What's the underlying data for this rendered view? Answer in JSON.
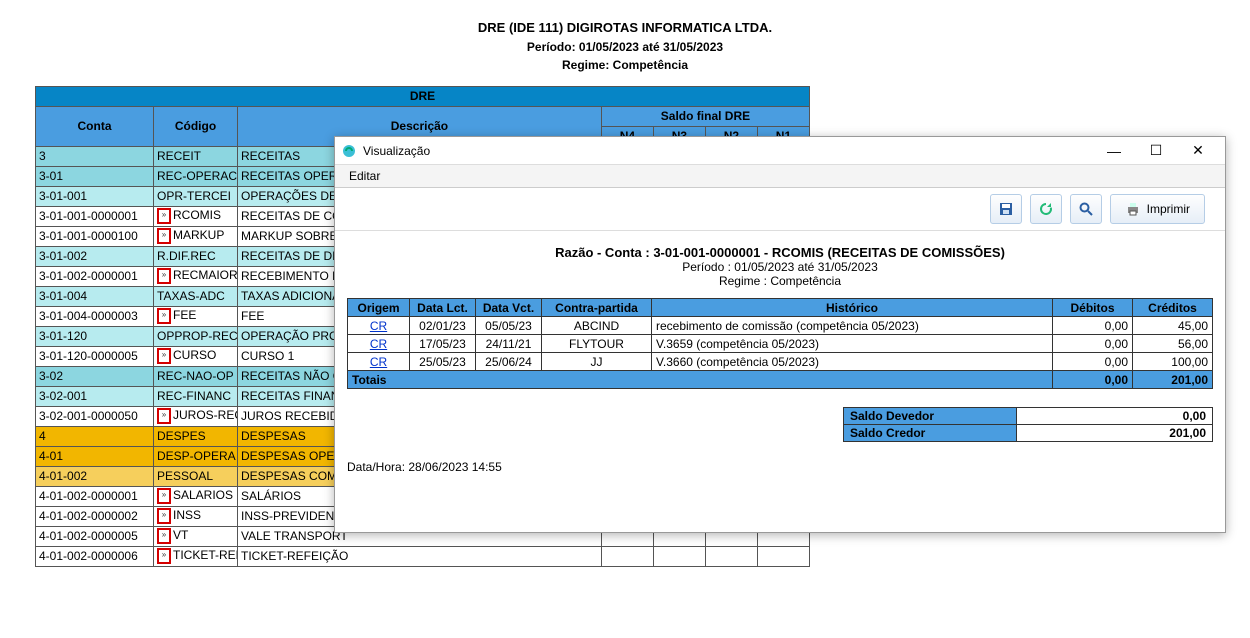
{
  "report": {
    "title": "DRE (IDE 111) DIGIROTAS INFORMATICA LTDA.",
    "periodo": "Período: 01/05/2023 até 31/05/2023",
    "regime": "Regime: Competência"
  },
  "dre": {
    "title": "DRE",
    "headers": {
      "conta": "Conta",
      "codigo": "Código",
      "descricao": "Descrição",
      "saldo": "Saldo final DRE",
      "n4": "N4",
      "n3": "N3",
      "n2": "N2",
      "n1": "N1"
    },
    "rows": [
      {
        "lvl": "lvl1",
        "conta": "3",
        "codigo": "RECEIT",
        "desc": "RECEITAS",
        "mark": false
      },
      {
        "lvl": "lvl2",
        "conta": "3-01",
        "codigo": "REC-OPERAC",
        "desc": "RECEITAS OPERAC",
        "mark": false
      },
      {
        "lvl": "lvl3",
        "conta": "3-01-001",
        "codigo": "OPR-TERCEI",
        "desc": "OPERAÇÕES DE T",
        "mark": false
      },
      {
        "lvl": "lvl4",
        "conta": "3-01-001-0000001",
        "codigo": "RCOMIS",
        "desc": "RECEITAS DE CO",
        "mark": true
      },
      {
        "lvl": "lvl4",
        "conta": "3-01-001-0000100",
        "codigo": "MARKUP",
        "desc": "MARKUP SOBRE V",
        "mark": true
      },
      {
        "lvl": "lvl3",
        "conta": "3-01-002",
        "codigo": "R.DIF.REC",
        "desc": "RECEITAS DE DIFE",
        "mark": false
      },
      {
        "lvl": "lvl4",
        "conta": "3-01-002-0000001",
        "codigo": "RECMAIOR",
        "desc": "RECEBIMENTO DE",
        "mark": true
      },
      {
        "lvl": "lvl3",
        "conta": "3-01-004",
        "codigo": "TAXAS-ADC",
        "desc": "TAXAS ADICIONAI",
        "mark": false
      },
      {
        "lvl": "lvl4",
        "conta": "3-01-004-0000003",
        "codigo": "FEE",
        "desc": "FEE",
        "mark": true
      },
      {
        "lvl": "lvl3",
        "conta": "3-01-120",
        "codigo": "OPPROP-REC",
        "desc": "OPERAÇÃO PROP",
        "mark": false
      },
      {
        "lvl": "lvl4",
        "conta": "3-01-120-0000005",
        "codigo": "CURSO",
        "desc": "CURSO 1",
        "mark": true
      },
      {
        "lvl": "lvl2",
        "conta": "3-02",
        "codigo": "REC-NAO-OP",
        "desc": "RECEITAS NÃO OP",
        "mark": false
      },
      {
        "lvl": "lvl3",
        "conta": "3-02-001",
        "codigo": "REC-FINANC",
        "desc": "RECEITAS FINANC",
        "mark": false
      },
      {
        "lvl": "lvl4",
        "conta": "3-02-001-0000050",
        "codigo": "JUROS-REC",
        "desc": "JUROS RECEBIDO",
        "mark": true
      },
      {
        "lvl": "yellow1",
        "conta": "4",
        "codigo": "DESPES",
        "desc": "DESPESAS",
        "mark": false
      },
      {
        "lvl": "yellow2",
        "conta": "4-01",
        "codigo": "DESP-OPERA",
        "desc": "DESPESAS OPERAC",
        "mark": false
      },
      {
        "lvl": "yellow3",
        "conta": "4-01-002",
        "codigo": "PESSOAL",
        "desc": "DESPESAS COM PE",
        "mark": false
      },
      {
        "lvl": "yellow4",
        "conta": "4-01-002-0000001",
        "codigo": "SALARIOS",
        "desc": "SALÁRIOS",
        "mark": true
      },
      {
        "lvl": "yellow4",
        "conta": "4-01-002-0000002",
        "codigo": "INSS",
        "desc": "INSS-PREVIDENCI",
        "mark": true
      },
      {
        "lvl": "yellow4",
        "conta": "4-01-002-0000005",
        "codigo": "VT",
        "desc": "VALE TRANSPORT",
        "mark": true
      },
      {
        "lvl": "yellow4",
        "conta": "4-01-002-0000006",
        "codigo": "TICKET-REF",
        "desc": "TICKET-REFEIÇÃO",
        "mark": true
      }
    ]
  },
  "popup": {
    "title": "Visualização",
    "menu_editar": "Editar",
    "btn_imprimir": "Imprimir",
    "razao": {
      "title": "Razão - Conta : 3-01-001-0000001 - RCOMIS (RECEITAS DE COMISSÕES)",
      "periodo": "Período : 01/05/2023 até 31/05/2023",
      "regime": "Regime : Competência",
      "headers": {
        "origem": "Origem",
        "datalct": "Data Lct.",
        "datavct": "Data Vct.",
        "contra": "Contra-partida",
        "historico": "Histórico",
        "debitos": "Débitos",
        "creditos": "Créditos"
      },
      "rows": [
        {
          "origem": "CR",
          "lct": "02/01/23",
          "vct": "05/05/23",
          "contra": "ABCIND",
          "hist": "recebimento de comissão (competência 05/2023)",
          "deb": "0,00",
          "cred": "45,00"
        },
        {
          "origem": "CR",
          "lct": "17/05/23",
          "vct": "24/11/21",
          "contra": "FLYTOUR",
          "hist": "V.3659 (competência 05/2023)",
          "deb": "0,00",
          "cred": "56,00"
        },
        {
          "origem": "CR",
          "lct": "25/05/23",
          "vct": "25/06/24",
          "contra": "JJ",
          "hist": "V.3660 (competência 05/2023)",
          "deb": "0,00",
          "cred": "100,00"
        }
      ],
      "totais_label": "Totais",
      "totais_deb": "0,00",
      "totais_cred": "201,00",
      "saldo_dev_lbl": "Saldo Devedor",
      "saldo_dev": "0,00",
      "saldo_cred_lbl": "Saldo Credor",
      "saldo_cred": "201,00",
      "datahora": "Data/Hora:  28/06/2023 14:55"
    }
  }
}
